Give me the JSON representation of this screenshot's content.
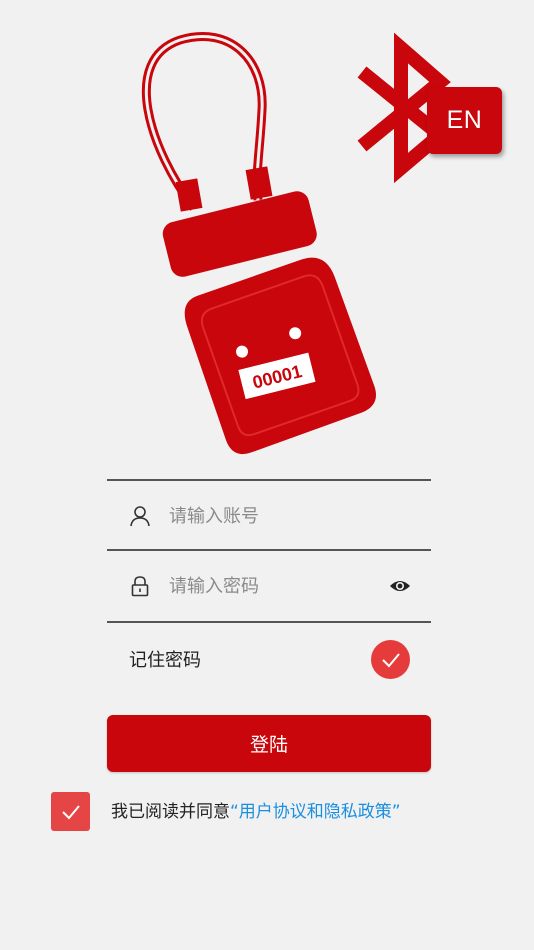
{
  "logo": {
    "seal_number": "00001",
    "icon": "padlock-seal-icon"
  },
  "bluetooth": {
    "icon": "bluetooth-icon",
    "color": "#c8060c"
  },
  "language_button": {
    "label": "EN"
  },
  "form": {
    "account": {
      "icon": "user-icon",
      "placeholder": "请输入账号",
      "value": ""
    },
    "password": {
      "icon": "lock-icon",
      "placeholder": "请输入密码",
      "value": "",
      "toggle_icon": "eye-icon"
    },
    "remember": {
      "label": "记住密码",
      "checked": true
    },
    "login_label": "登陆"
  },
  "agreement": {
    "checked": true,
    "prefix": "我已阅读并同意",
    "link_text": "“用户协议和隐私政策”"
  },
  "colors": {
    "brand_red": "#c8060c",
    "check_red": "#e53b3b",
    "link_blue": "#1a8fe0",
    "background": "#f1f1f2"
  }
}
